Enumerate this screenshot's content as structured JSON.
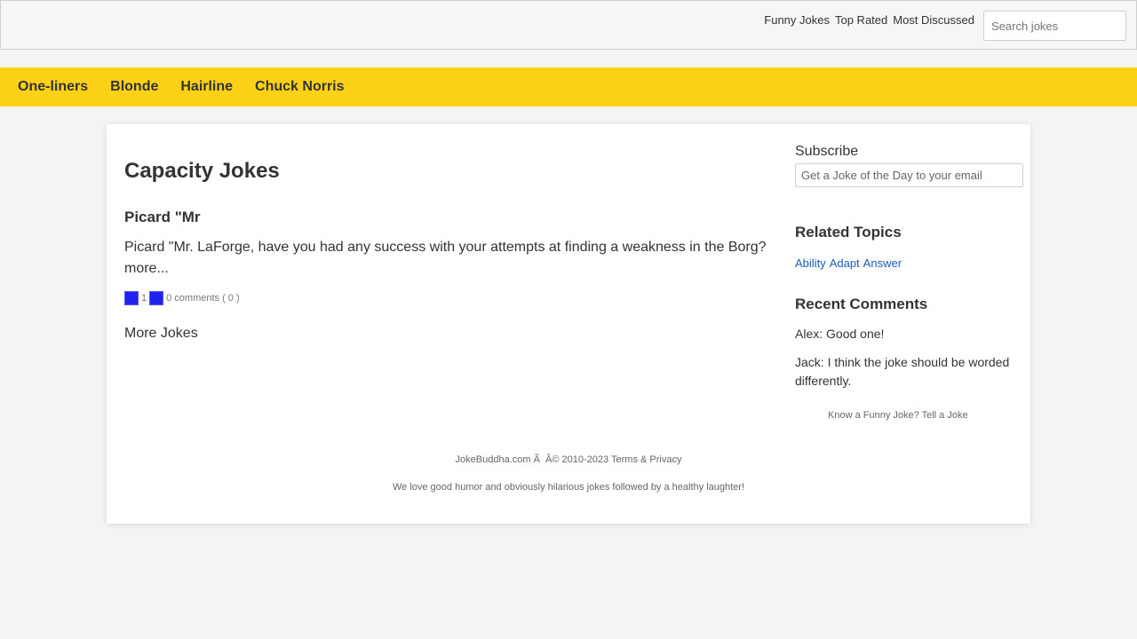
{
  "nav": {
    "links": [
      "Funny Jokes",
      "Top Rated",
      "Most Discussed"
    ],
    "search_placeholder": "Search jokes"
  },
  "categories": [
    "One-liners",
    "Blonde",
    "Hairline",
    "Chuck Norris"
  ],
  "main": {
    "page_title": "Capacity Jokes",
    "joke": {
      "title": "Picard \"Mr",
      "body": "Picard \"Mr. LaForge, have you had any success with your attempts at finding a weakness in the Borg? more...",
      "votes": "1",
      "comments": "0 comments ( 0 )"
    },
    "more_jokes": "More Jokes"
  },
  "sidebar": {
    "subscribe_label": "Subscribe",
    "subscribe_placeholder": "Get a Joke of the Day to your email",
    "related_heading": "Related Topics",
    "topics": [
      "Ability",
      "Adapt",
      "Answer"
    ],
    "comments_heading": "Recent Comments",
    "comments": [
      "Alex: Good one!",
      "Jack: I think the joke should be worded differently."
    ],
    "tell_joke": "Know a Funny Joke? Tell a Joke"
  },
  "footer": {
    "copyright": "JokeBuddha.com Ã  Â© 2010-2023 Terms & Privacy",
    "tagline": "We love good humor and obviously hilarious jokes followed by a healthy laughter!"
  },
  "colors": {
    "category_bar": "#fdd116",
    "vote_button": "#2222ee",
    "topic_link": "#1a5fb4"
  }
}
